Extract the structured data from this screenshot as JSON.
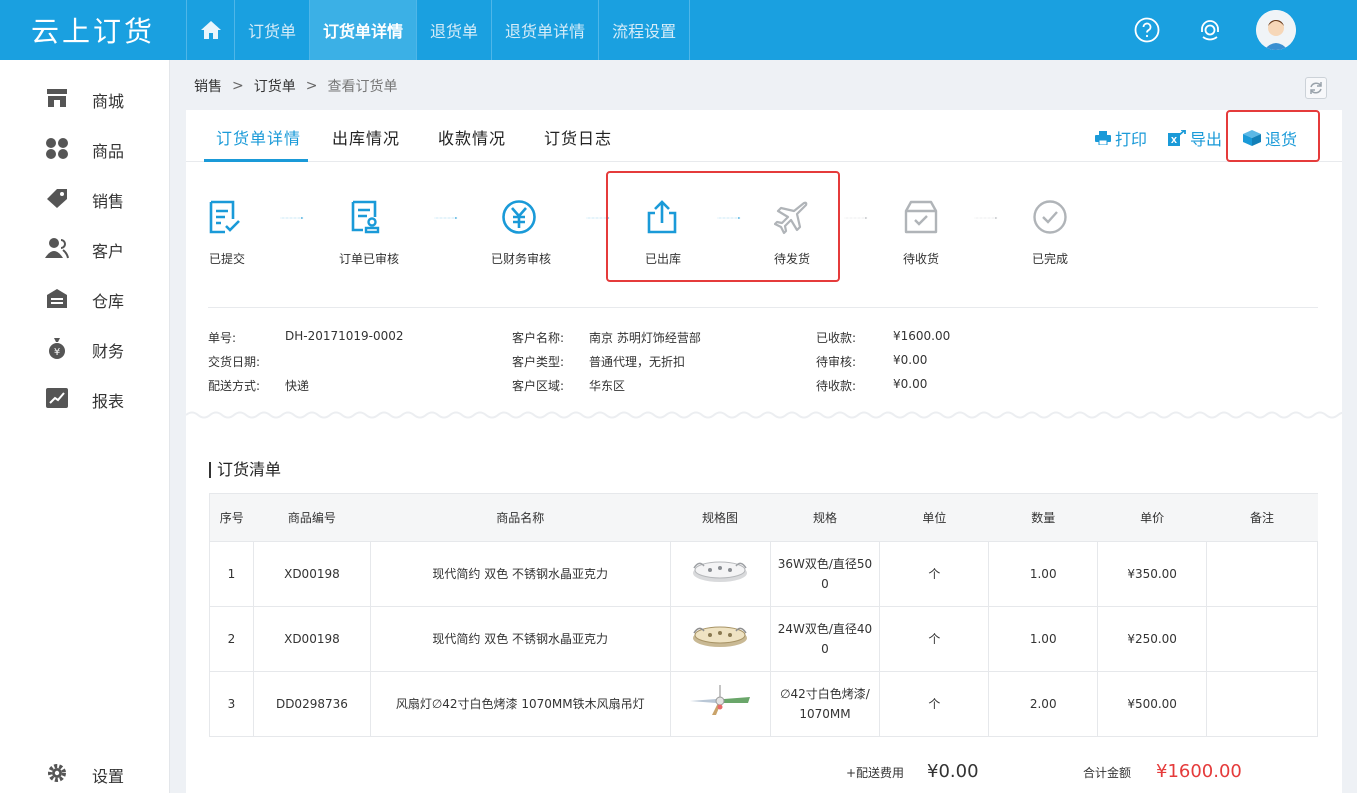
{
  "app": {
    "logo_text": "云上订货"
  },
  "nav": {
    "items": [
      "订货单",
      "订货单详情",
      "退货单",
      "退货单详情",
      "流程设置"
    ],
    "active_index": 1
  },
  "sidebar": {
    "items": [
      {
        "label": "商城",
        "icon": "store-icon"
      },
      {
        "label": "商品",
        "icon": "grid-icon"
      },
      {
        "label": "销售",
        "icon": "tag-icon"
      },
      {
        "label": "客户",
        "icon": "user-icon"
      },
      {
        "label": "仓库",
        "icon": "warehouse-icon"
      },
      {
        "label": "财务",
        "icon": "money-bag-icon"
      },
      {
        "label": "报表",
        "icon": "chart-icon"
      }
    ],
    "settings_label": "设置"
  },
  "breadcrumb": {
    "items": [
      "销售",
      "订货单",
      "查看订货单"
    ],
    "sep": ">"
  },
  "tabs": [
    "订货单详情",
    "出库情况",
    "收款情况",
    "订货日志"
  ],
  "actions": {
    "print": "打印",
    "export": "导出",
    "return": "退货"
  },
  "steps": [
    {
      "label": "已提交",
      "done": true
    },
    {
      "label": "订单已审核",
      "done": true
    },
    {
      "label": "已财务审核",
      "done": true
    },
    {
      "label": "已出库",
      "done": true
    },
    {
      "label": "待发货",
      "done": false
    },
    {
      "label": "待收货",
      "done": false
    },
    {
      "label": "已完成",
      "done": false
    }
  ],
  "info": {
    "order_no_label": "单号:",
    "order_no": "DH-20171019-0002",
    "delivery_date_label": "交货日期:",
    "delivery_date": "",
    "shipping_label": "配送方式:",
    "shipping": "快递",
    "customer_label": "客户名称:",
    "customer": "南京 苏明灯饰经营部",
    "customer_type_label": "客户类型:",
    "customer_type": "普通代理，无折扣",
    "region_label": "客户区域:",
    "region": "华东区",
    "received_label": "已收款:",
    "received": "¥1600.00",
    "pending_review_label": "待审核:",
    "pending_review": "¥0.00",
    "pending_receive_label": "待收款:",
    "pending_receive": "¥0.00"
  },
  "order_list": {
    "title": "订货清单",
    "headers": [
      "序号",
      "商品编号",
      "商品名称",
      "规格图",
      "规格",
      "单位",
      "数量",
      "单价",
      "备注"
    ],
    "rows": [
      {
        "no": "1",
        "code": "XD00198",
        "name": "现代简约 双色 不锈钢水晶亚克力",
        "spec_line1": "36W双色/直径50",
        "spec_line2": "0",
        "unit": "个",
        "qty": "1.00",
        "price": "¥350.00",
        "note": ""
      },
      {
        "no": "2",
        "code": "XD00198",
        "name": "现代简约 双色 不锈钢水晶亚克力",
        "spec_line1": "24W双色/直径40",
        "spec_line2": "0",
        "unit": "个",
        "qty": "1.00",
        "price": "¥250.00",
        "note": ""
      },
      {
        "no": "3",
        "code": "DD0298736",
        "name": "风扇灯∅42寸白色烤漆 1070MM铁木风扇吊灯",
        "spec_line1": "∅42寸白色烤漆/",
        "spec_line2": "1070MM",
        "unit": "个",
        "qty": "2.00",
        "price": "¥500.00",
        "note": ""
      }
    ]
  },
  "footer": {
    "shipping_fee_label": "+配送费用",
    "shipping_fee": "¥0.00",
    "total_label": "合计金额",
    "total": "¥1600.00"
  },
  "colors": {
    "brand": "#1aa0e0",
    "accent": "#1a9ad8",
    "highlight": "#e53b3b"
  }
}
